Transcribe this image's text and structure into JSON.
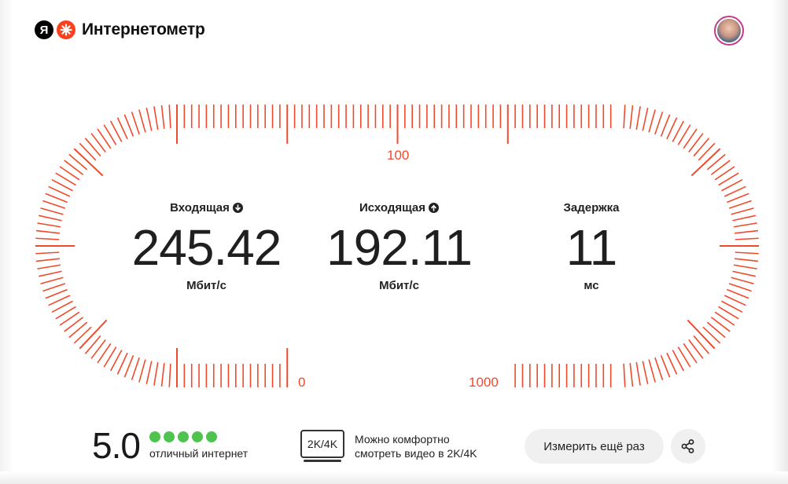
{
  "header": {
    "logo_letter": "Я",
    "title": "Интернетометр",
    "logo_color": "#fc3f1d"
  },
  "gauge": {
    "scale_labels": [
      "100",
      "0",
      "1000"
    ],
    "tick_color": "#f04a2c"
  },
  "metrics": [
    {
      "label": "Входящая",
      "icon": "arrow-down-icon",
      "value": "245.42",
      "unit": "Мбит/с"
    },
    {
      "label": "Исходящая",
      "icon": "arrow-up-icon",
      "value": "192.11",
      "unit": "Мбит/с"
    },
    {
      "label": "Задержка",
      "icon": "",
      "value": "11",
      "unit": "мс"
    }
  ],
  "rating": {
    "score": "5.0",
    "stars_filled": 5,
    "stars_total": 5,
    "star_color": "#4ec44e",
    "text": "отличный интернет"
  },
  "quality": {
    "badge": "2K/4K",
    "line1": "Можно комфортно",
    "line2": "смотреть видео в 2K/4K"
  },
  "actions": {
    "retry_label": "Измерить ещё раз",
    "share_icon": "share-icon"
  }
}
